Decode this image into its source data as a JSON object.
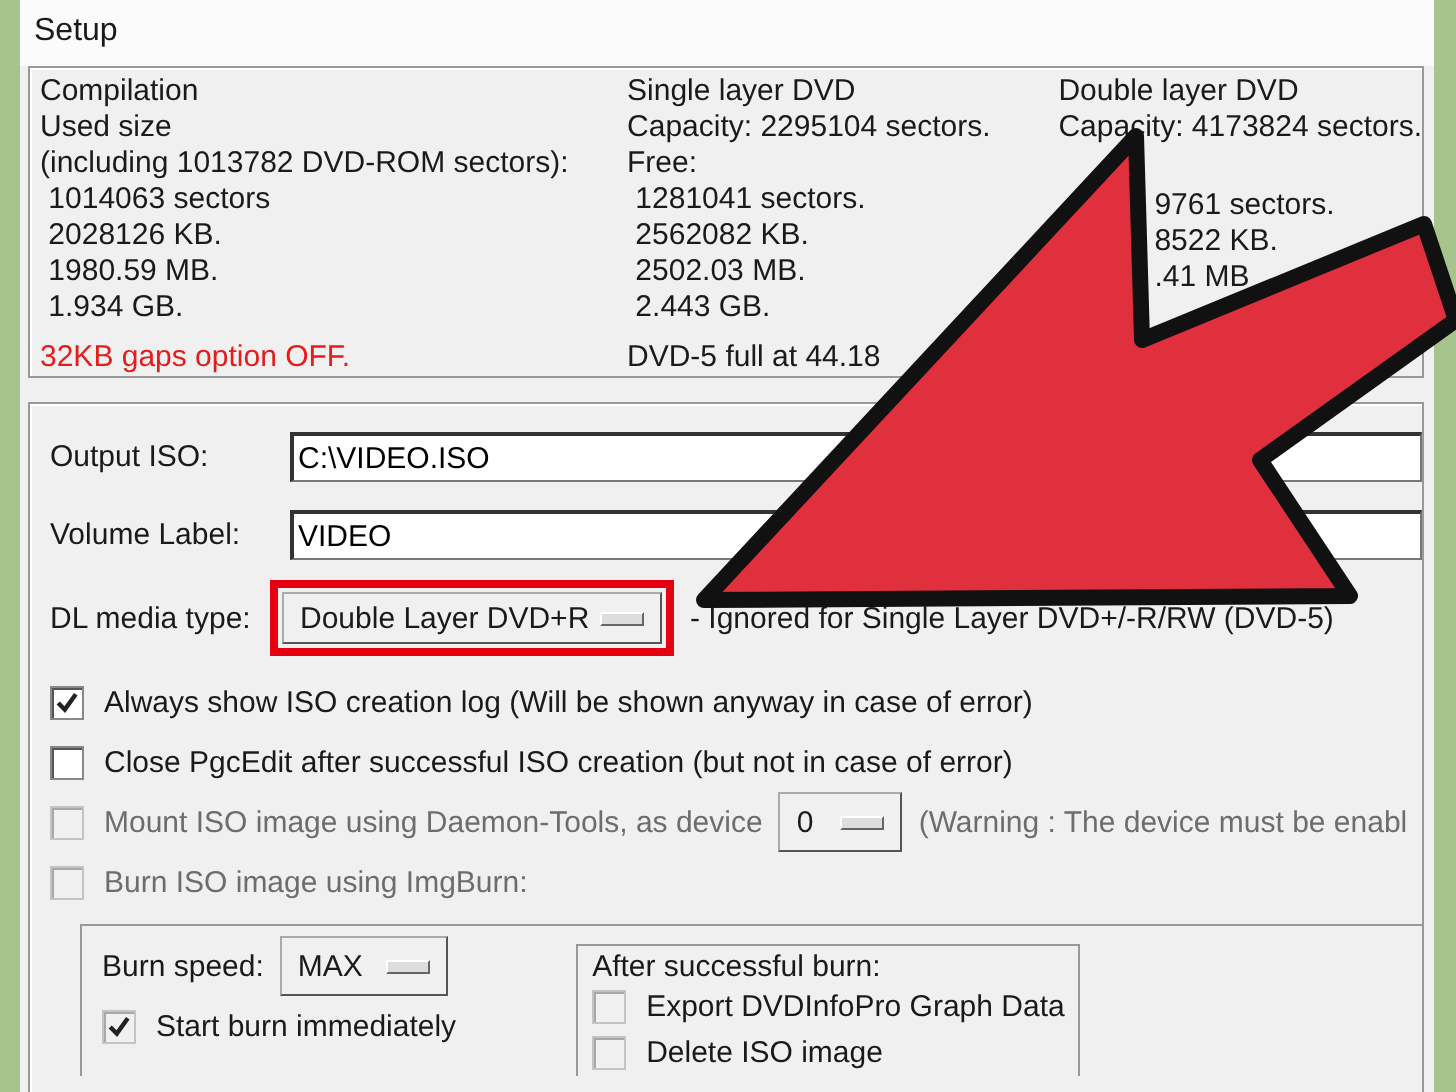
{
  "window": {
    "title": "Setup"
  },
  "summary": {
    "columns": [
      {
        "lines": [
          "Compilation",
          "Used size",
          "(including 1013782 DVD-ROM sectors):",
          " 1014063 sectors",
          " 2028126 KB.",
          " 1980.59 MB.",
          " 1.934 GB."
        ],
        "footer": {
          "text": "32KB gaps option OFF.",
          "color": "#e41c1c"
        }
      },
      {
        "lines": [
          "Single layer DVD",
          "Capacity: 2295104 sectors.",
          "Free:",
          " 1281041 sectors.",
          " 2562082 KB.",
          " 2502.03 MB.",
          " 2.443 GB."
        ],
        "footer": {
          "text": "DVD-5 full at 44.18",
          "color": "#1a1a1a"
        }
      },
      {
        "lines": [
          "Double layer DVD",
          "Capacity: 4173824 sectors."
        ],
        "lower_lines": [
          "9761 sectors.",
          "8522 KB.",
          ".41 MB"
        ]
      }
    ]
  },
  "output_iso": {
    "label": "Output ISO:",
    "value": "C:\\VIDEO.ISO"
  },
  "volume_label": {
    "label": "Volume Label:",
    "value": "VIDEO"
  },
  "dl_media": {
    "label": "DL media type:",
    "value": "Double Layer DVD+R",
    "highlighted": true,
    "note": "- Ignored for Single Layer DVD+/-R/RW (DVD-5)"
  },
  "options": [
    {
      "label": "Always show ISO creation log  (Will be shown anyway in case of error)",
      "checked": true,
      "disabled": false
    },
    {
      "label": "Close PgcEdit after successful ISO creation (but not in case of error)",
      "checked": false,
      "disabled": false
    },
    {
      "label": "Mount ISO image using Daemon-Tools, as device",
      "checked": false,
      "disabled": true,
      "dropdown": "0",
      "note": "(Warning : The device must be enabl"
    },
    {
      "label": "Burn ISO image using ImgBurn:",
      "checked": false,
      "disabled": true
    }
  ],
  "burn": {
    "speed_label": "Burn speed:",
    "speed_value": "MAX",
    "start": {
      "label": "Start burn immediately",
      "checked": true,
      "disabled": true
    },
    "after": {
      "title": "After successful burn:",
      "options": [
        {
          "label": "Export DVDInfoPro Graph Data",
          "checked": false,
          "disabled": true
        },
        {
          "label": "Delete ISO image",
          "checked": false,
          "disabled": true
        }
      ]
    }
  }
}
